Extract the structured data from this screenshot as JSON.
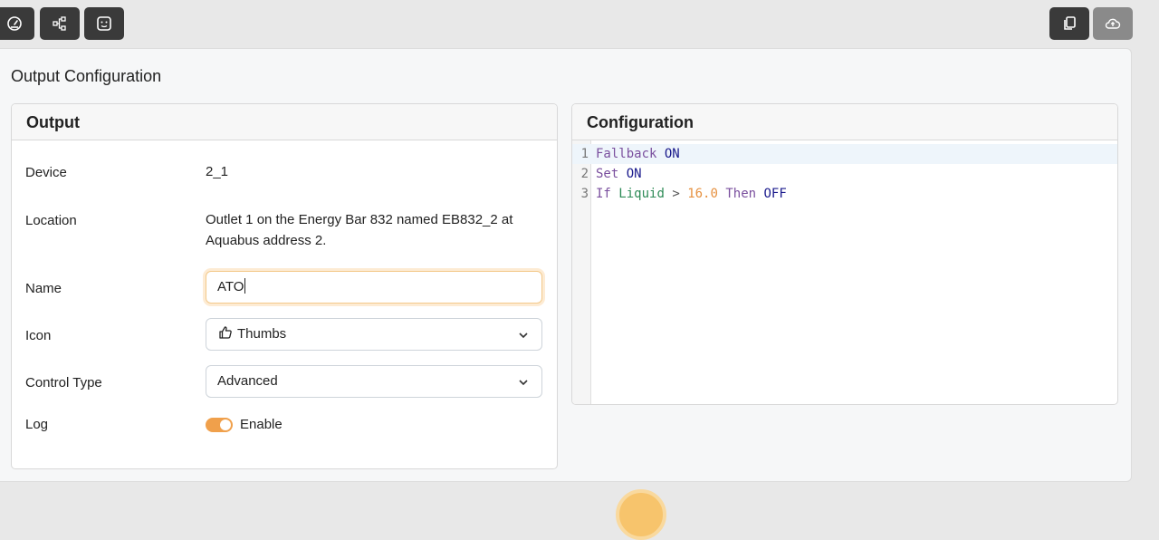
{
  "toolbar": {
    "left_icons": [
      "dashboard-icon",
      "workflow-icon",
      "outlet-icon"
    ],
    "right_icons": [
      "copy-icon",
      "cloud-upload-icon"
    ]
  },
  "page": {
    "title": "Output Configuration"
  },
  "output_card": {
    "header": "Output",
    "device_label": "Device",
    "device_value": "2_1",
    "location_label": "Location",
    "location_value": "Outlet 1 on the Energy Bar 832 named EB832_2 at Aquabus address 2.",
    "name_label": "Name",
    "name_value": "ATO",
    "icon_label": "Icon",
    "icon_value": "Thumbs",
    "icon_glyph": "thumbs-up-icon",
    "control_type_label": "Control Type",
    "control_type_value": "Advanced",
    "log_label": "Log",
    "log_toggle_label": "Enable",
    "log_enabled": true
  },
  "config_card": {
    "header": "Configuration",
    "lines": [
      {
        "n": "1",
        "tokens": [
          {
            "t": "Fallback",
            "c": "kw"
          },
          {
            "t": " "
          },
          {
            "t": "ON",
            "c": "val"
          }
        ]
      },
      {
        "n": "2",
        "tokens": [
          {
            "t": "Set",
            "c": "kw"
          },
          {
            "t": " "
          },
          {
            "t": "ON",
            "c": "val"
          }
        ]
      },
      {
        "n": "3",
        "tokens": [
          {
            "t": "If",
            "c": "kw"
          },
          {
            "t": " "
          },
          {
            "t": "Liquid",
            "c": "id"
          },
          {
            "t": " "
          },
          {
            "t": ">",
            "c": "op"
          },
          {
            "t": " "
          },
          {
            "t": "16.0",
            "c": "num"
          },
          {
            "t": " "
          },
          {
            "t": "Then",
            "c": "kw"
          },
          {
            "t": " "
          },
          {
            "t": "OFF",
            "c": "val"
          }
        ]
      }
    ]
  },
  "colors": {
    "accent": "#f0a04b",
    "toolbar_button": "#3a3a3a",
    "toolbar_button_disabled": "#8a8a8a"
  }
}
